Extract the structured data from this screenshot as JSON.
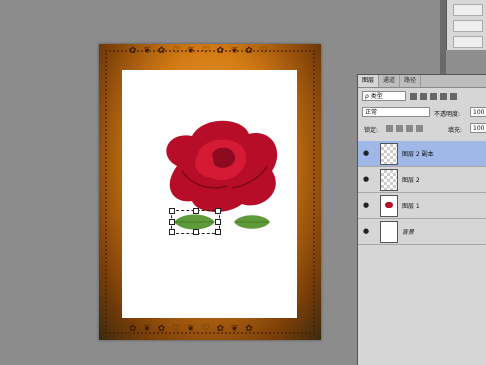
{
  "panel": {
    "tabs": [
      "图层",
      "通道",
      "路径"
    ],
    "filter_kind": "ρ 类型",
    "blend_mode": "正常",
    "opacity_label": "不透明度:",
    "opacity_value": "100",
    "lock_label": "锁定:",
    "fill_label": "填充:",
    "fill_value": "100",
    "layers": [
      {
        "name": "图层 2 副本",
        "selected": true
      },
      {
        "name": "图层 2",
        "selected": false
      },
      {
        "name": "图层 1",
        "selected": false
      },
      {
        "name": "背景",
        "selected": false
      }
    ]
  },
  "colors": {
    "selection": "#9fb8e8",
    "rose": "#c8102e",
    "leaf": "#5f9a3a"
  }
}
